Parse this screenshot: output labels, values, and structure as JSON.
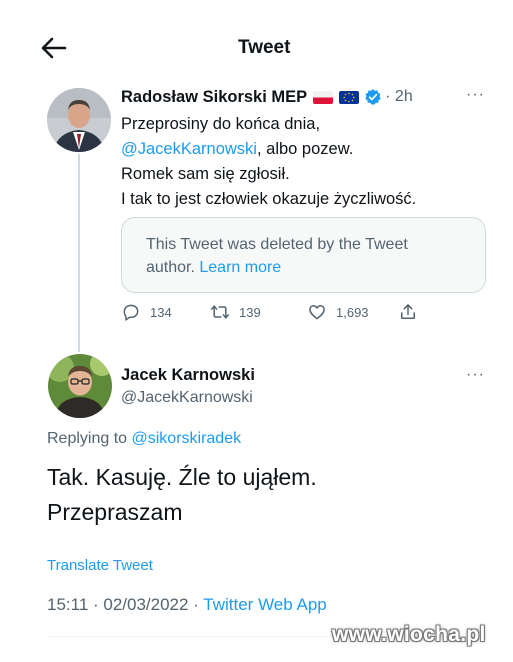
{
  "header": {
    "title": "Tweet",
    "back_icon": "arrow-left-icon"
  },
  "tweet": {
    "author_name": "Radosław Sikorski MEP",
    "flags": [
      "flag-poland-icon",
      "flag-eu-icon"
    ],
    "verified_icon": "verified-badge-icon",
    "time": "· 2h",
    "more": "···",
    "lines": [
      {
        "before": "Przeprosiny do końca dnia,",
        "mention": "",
        "after": ""
      },
      {
        "before": "",
        "mention": "@JacekKarnowski",
        "after": ", albo pozew."
      },
      {
        "before": "Romek sam się zgłosił.",
        "mention": "",
        "after": ""
      },
      {
        "before": "I tak to jest człowiek okazuje życzliwość.",
        "mention": "",
        "after": ""
      }
    ],
    "deleted_card": {
      "line1": "This Tweet was deleted by the Tweet",
      "line2_text": "author. ",
      "learn_more": "Learn more"
    },
    "actions": {
      "replies": "134",
      "retweets": "139",
      "likes": "1,693"
    }
  },
  "reply": {
    "author_name": "Jacek Karnowski",
    "handle": "@JacekKarnowski",
    "more": "···",
    "replying_prefix": "Replying to ",
    "replying_to": "@sikorskiradek",
    "lines": [
      "Tak. Kasuję. Źle to ująłem.",
      "Przepraszam"
    ],
    "translate": "Translate Tweet",
    "meta_time": "15:11 · 02/03/2022 · ",
    "meta_app": "Twitter Web App"
  },
  "watermark": "www.wiocha.pl",
  "colors": {
    "link": "#1d9bf0",
    "text": "#0f1419",
    "muted": "#536471",
    "border": "#cfd9de"
  }
}
